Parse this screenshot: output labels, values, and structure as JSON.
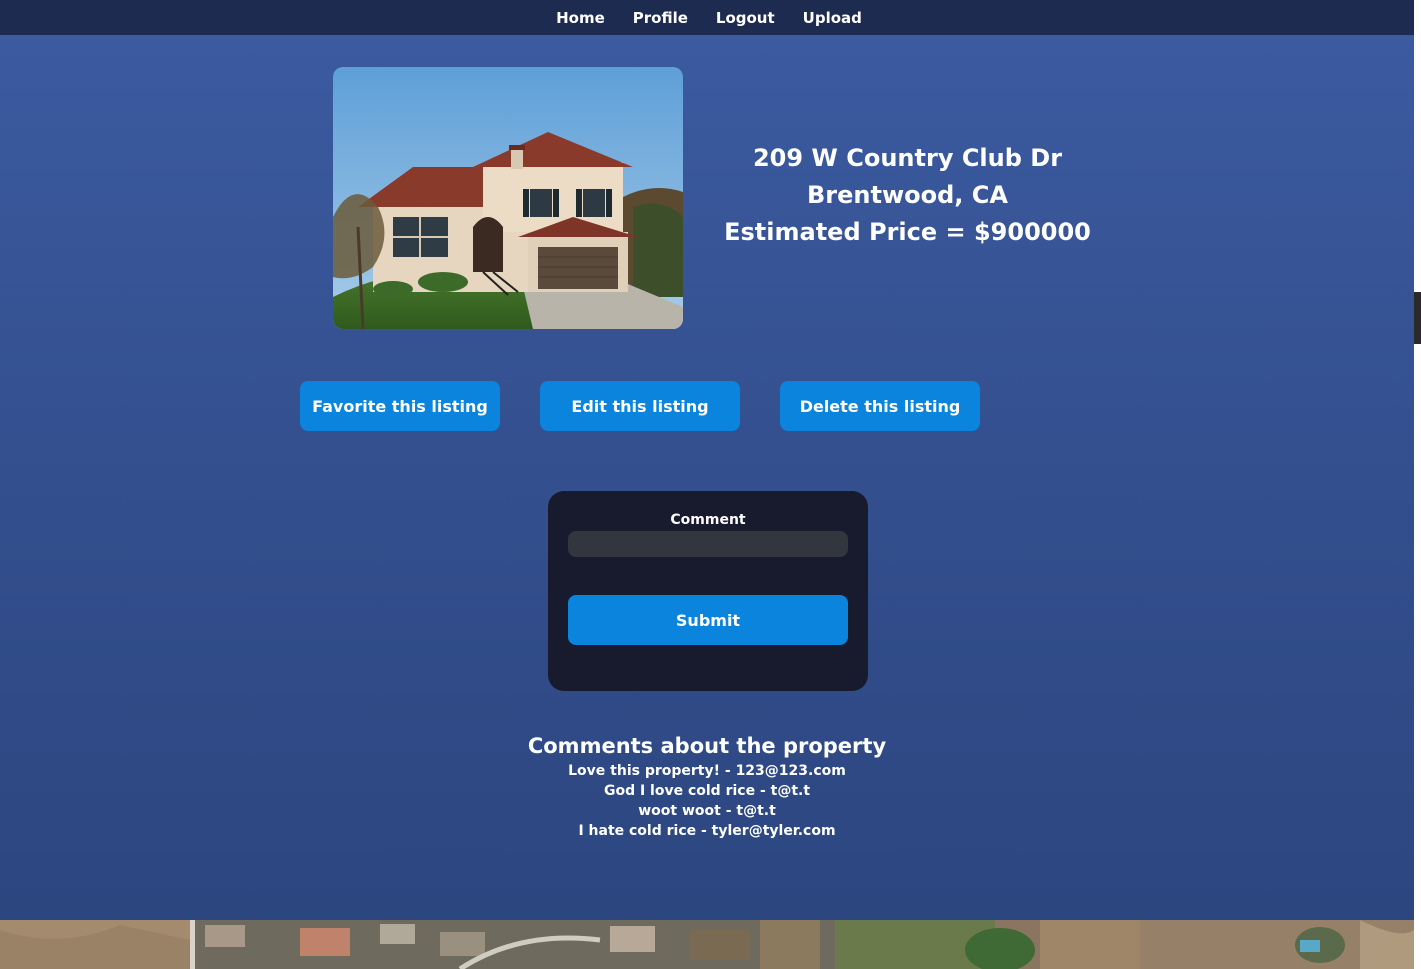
{
  "nav": {
    "links": [
      {
        "label": "Home"
      },
      {
        "label": "Profile"
      },
      {
        "label": "Logout"
      },
      {
        "label": "Upload"
      }
    ]
  },
  "listing": {
    "address": "209 W Country Club Dr Brentwood, CA",
    "price_text": "Estimated Price = $900000"
  },
  "actions": {
    "favorite_label": "Favorite this listing",
    "edit_label": "Edit this listing",
    "delete_label": "Delete this listing"
  },
  "comment_form": {
    "label": "Comment",
    "value": "",
    "submit_label": "Submit"
  },
  "comments": {
    "heading": "Comments about the property",
    "items": [
      {
        "text": "Love this property! - 123@123.com"
      },
      {
        "text": "God I love cold rice - t@t.t"
      },
      {
        "text": "woot woot - t@t.t"
      },
      {
        "text": "I hate cold rice - tyler@tyler.com"
      }
    ]
  },
  "colors": {
    "navbar": "#1e2b50",
    "page_background": "#3b5aa0",
    "button": "#0a84dc",
    "card": "#181a2e"
  }
}
